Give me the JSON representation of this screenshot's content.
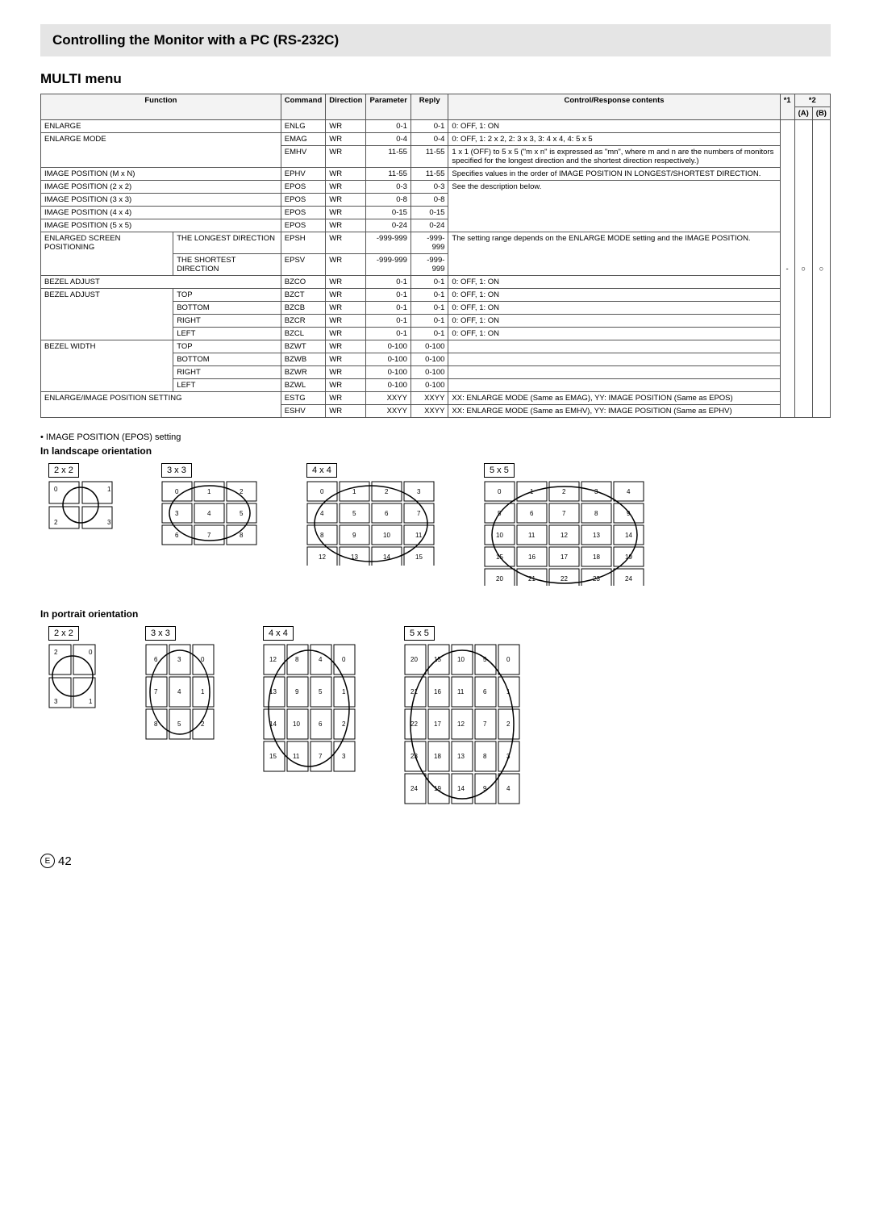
{
  "header_title": "Controlling the Monitor with a PC (RS-232C)",
  "menu_title": "MULTI menu",
  "th": {
    "func": "Function",
    "cmd": "Command",
    "dir": "Direction",
    "param": "Parameter",
    "reply": "Reply",
    "ctrl": "Control/Response contents",
    "s1": "*1",
    "s2": "*2",
    "a": "(A)",
    "b": "(B)"
  },
  "rows": [
    {
      "f": "ENLARGE",
      "sub": "",
      "c": "ENLG",
      "d": "WR",
      "p": "0-1",
      "r": "0-1",
      "ctl": "0: OFF, 1: ON"
    },
    {
      "f": "ENLARGE MODE",
      "sub": "",
      "c": "EMAG",
      "d": "WR",
      "p": "0-4",
      "r": "0-4",
      "ctl": "0: OFF, 1: 2 x 2, 2: 3 x 3, 3: 4 x 4, 4: 5 x 5"
    },
    {
      "f": "",
      "sub": "",
      "c": "EMHV",
      "d": "WR",
      "p": "11-55",
      "r": "11-55",
      "ctl": "1 x 1 (OFF) to 5 x 5 (\"m x n\" is expressed as \"mn\", where m and n are the numbers of monitors specified for the longest direction and the shortest direction respectively.)"
    },
    {
      "f": "IMAGE POSITION (M x N)",
      "sub": "",
      "c": "EPHV",
      "d": "WR",
      "p": "11-55",
      "r": "11-55",
      "ctl": "Specifies values in the order of IMAGE POSITION IN LONGEST/SHORTEST DIRECTION."
    },
    {
      "f": "IMAGE POSITION (2 x 2)",
      "sub": "",
      "c": "EPOS",
      "d": "WR",
      "p": "0-3",
      "r": "0-3",
      "ctl": "See the description below."
    },
    {
      "f": "IMAGE POSITION (3 x 3)",
      "sub": "",
      "c": "EPOS",
      "d": "WR",
      "p": "0-8",
      "r": "0-8",
      "ctl": ""
    },
    {
      "f": "IMAGE POSITION (4 x 4)",
      "sub": "",
      "c": "EPOS",
      "d": "WR",
      "p": "0-15",
      "r": "0-15",
      "ctl": ""
    },
    {
      "f": "IMAGE POSITION (5 x 5)",
      "sub": "",
      "c": "EPOS",
      "d": "WR",
      "p": "0-24",
      "r": "0-24",
      "ctl": ""
    },
    {
      "f": "ENLARGED SCREEN POSITIONING",
      "sub": "THE LONGEST DIRECTION",
      "c": "EPSH",
      "d": "WR",
      "p": "-999-999",
      "r": "-999-999",
      "ctl": "The setting range depends on the ENLARGE MODE setting and the IMAGE POSITION."
    },
    {
      "f": "",
      "sub": "THE SHORTEST DIRECTION",
      "c": "EPSV",
      "d": "WR",
      "p": "-999-999",
      "r": "-999-999",
      "ctl": ""
    },
    {
      "f": "BEZEL ADJUST",
      "sub": "",
      "c": "BZCO",
      "d": "WR",
      "p": "0-1",
      "r": "0-1",
      "ctl": "0: OFF, 1: ON"
    },
    {
      "f": "BEZEL ADJUST",
      "sub": "TOP",
      "c": "BZCT",
      "d": "WR",
      "p": "0-1",
      "r": "0-1",
      "ctl": "0: OFF, 1: ON"
    },
    {
      "f": "",
      "sub": "BOTTOM",
      "c": "BZCB",
      "d": "WR",
      "p": "0-1",
      "r": "0-1",
      "ctl": "0: OFF, 1: ON"
    },
    {
      "f": "",
      "sub": "RIGHT",
      "c": "BZCR",
      "d": "WR",
      "p": "0-1",
      "r": "0-1",
      "ctl": "0: OFF, 1: ON"
    },
    {
      "f": "",
      "sub": "LEFT",
      "c": "BZCL",
      "d": "WR",
      "p": "0-1",
      "r": "0-1",
      "ctl": "0: OFF, 1: ON"
    },
    {
      "f": "BEZEL WIDTH",
      "sub": "TOP",
      "c": "BZWT",
      "d": "WR",
      "p": "0-100",
      "r": "0-100",
      "ctl": ""
    },
    {
      "f": "",
      "sub": "BOTTOM",
      "c": "BZWB",
      "d": "WR",
      "p": "0-100",
      "r": "0-100",
      "ctl": ""
    },
    {
      "f": "",
      "sub": "RIGHT",
      "c": "BZWR",
      "d": "WR",
      "p": "0-100",
      "r": "0-100",
      "ctl": ""
    },
    {
      "f": "",
      "sub": "LEFT",
      "c": "BZWL",
      "d": "WR",
      "p": "0-100",
      "r": "0-100",
      "ctl": ""
    },
    {
      "f": "ENLARGE/IMAGE POSITION SETTING",
      "sub": "",
      "c": "ESTG",
      "d": "WR",
      "p": "XXYY",
      "r": "XXYY",
      "ctl": "XX: ENLARGE MODE (Same as EMAG), YY: IMAGE POSITION (Same as EPOS)"
    },
    {
      "f": "",
      "sub": "",
      "c": "ESHV",
      "d": "WR",
      "p": "XXYY",
      "r": "XXYY",
      "ctl": "XX: ENLARGE MODE (Same as EMHV), YY: IMAGE POSITION (Same as EPHV)"
    }
  ],
  "right": {
    "dash": "-",
    "circ": "○"
  },
  "epos_heading": "• IMAGE POSITION (EPOS) setting",
  "landscape": "In landscape orientation",
  "portrait": "In portrait orientation",
  "labels": {
    "g22": "2 x 2",
    "g33": "3 x 3",
    "g44": "4 x 4",
    "g55": "5 x 5"
  },
  "page_e": "E",
  "page_num": "42"
}
